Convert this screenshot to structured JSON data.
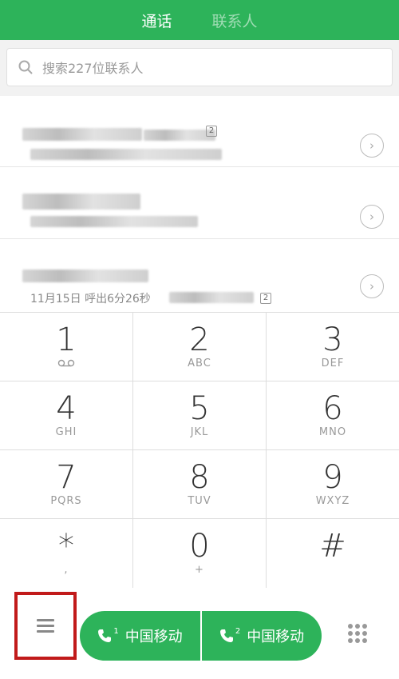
{
  "header": {
    "tabs": [
      "通话",
      "联系人"
    ],
    "active": 0
  },
  "search": {
    "placeholder": "搜索227位联系人"
  },
  "calls": [
    {
      "meta": "",
      "badge": ""
    },
    {
      "meta": "",
      "badge": "2"
    },
    {
      "meta": "11月15日 呼出6分26秒",
      "badge": "2"
    }
  ],
  "keypad": [
    {
      "num": "1",
      "sub": ""
    },
    {
      "num": "2",
      "sub": "ABC"
    },
    {
      "num": "3",
      "sub": "DEF"
    },
    {
      "num": "4",
      "sub": "GHI"
    },
    {
      "num": "5",
      "sub": "JKL"
    },
    {
      "num": "6",
      "sub": "MNO"
    },
    {
      "num": "7",
      "sub": "PQRS"
    },
    {
      "num": "8",
      "sub": "TUV"
    },
    {
      "num": "9",
      "sub": "WXYZ"
    },
    {
      "num": "*",
      "sub": ","
    },
    {
      "num": "0",
      "sub": "+"
    },
    {
      "num": "#",
      "sub": ""
    }
  ],
  "bottom": {
    "sim1": {
      "label": "中国移动",
      "sim": "1"
    },
    "sim2": {
      "label": "中国移动",
      "sim": "2"
    }
  },
  "colors": {
    "accent": "#2db35a",
    "highlight_box": "#c11a1a"
  }
}
